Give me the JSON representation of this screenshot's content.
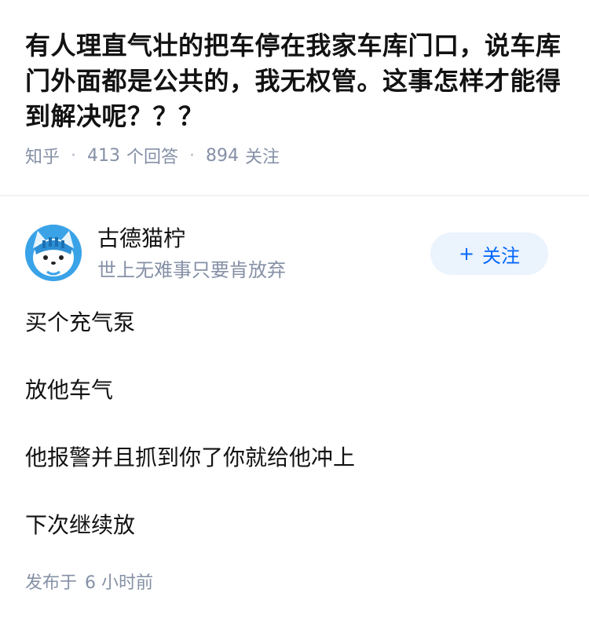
{
  "question": {
    "title": "有人理直气壮的把车停在我家车库门口，说车库门外面都是公共的，我无权管。这事怎样才能得到解决呢？？？",
    "source": "知乎",
    "answer_count": "413",
    "answer_label": "个回答",
    "follower_count": "894",
    "follower_label": "关注"
  },
  "answer": {
    "author": {
      "name": "古德猫柠",
      "bio": "世上无难事只要肯放弃",
      "avatar_icon": "cartoon-cat-avatar"
    },
    "follow_button": {
      "plus": "+",
      "label": "关注"
    },
    "paragraphs": [
      "买个充气泵",
      "放他车气",
      "他报警并且抓到你了你就给他冲上",
      "下次继续放"
    ],
    "publish_label": "发布于",
    "publish_time": "6 小时前"
  },
  "colors": {
    "text": "#121212",
    "meta": "#8590a6",
    "accent": "#0066ff",
    "follow_bg": "#ebf3fd"
  }
}
